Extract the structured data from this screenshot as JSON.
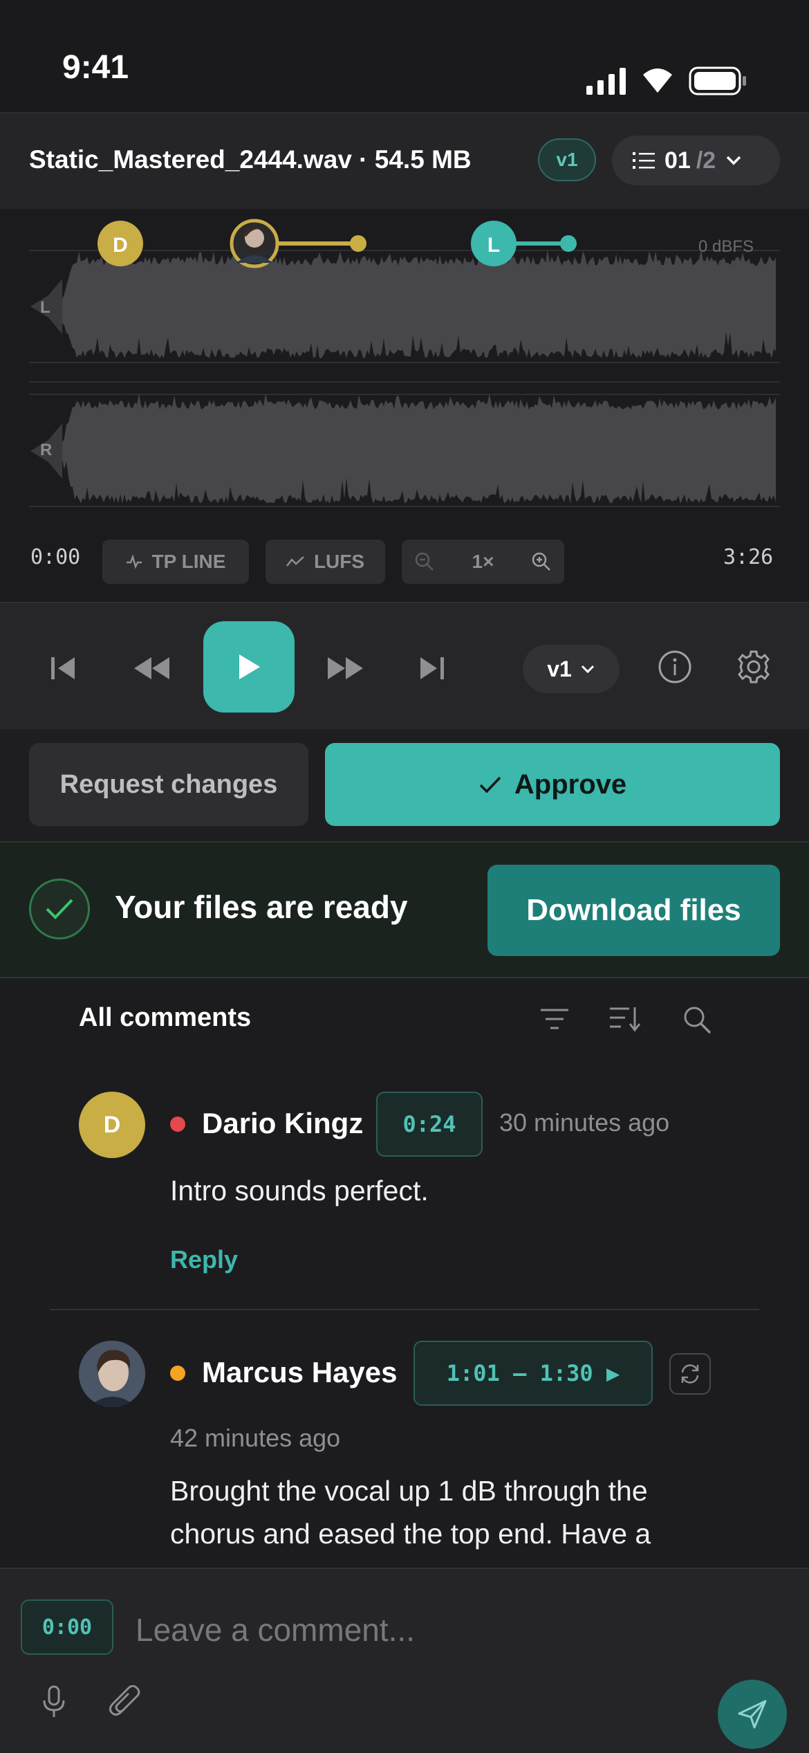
{
  "status_bar": {
    "time": "9:41"
  },
  "file": {
    "name": "Static_Mastered_2444.wav · 54.5 MB",
    "version_badge": "v1",
    "pager_current": "01",
    "pager_total": "/2"
  },
  "waveform": {
    "markers": [
      {
        "initial": "D",
        "color": "#c9ad45"
      },
      {
        "initial": "",
        "color": "#c9ad45"
      },
      {
        "initial": "L",
        "color": "#3cb8ac"
      }
    ],
    "dbfs_label": "0 dBFS",
    "channel_left": "L",
    "channel_right": "R",
    "start_time": "0:00",
    "end_time": "3:26",
    "tp_line_label": "TP LINE",
    "lufs_label": "LUFS",
    "zoom_level": "1×"
  },
  "transport": {
    "version_select": "v1"
  },
  "actions": {
    "request_changes": "Request changes",
    "approve": "Approve"
  },
  "ready_banner": {
    "text": "Your files are ready",
    "download": "Download files"
  },
  "comments": {
    "header": "All comments",
    "items": [
      {
        "author": "Dario Kingz",
        "initial": "D",
        "status_color": "#e5484d",
        "timestamp": "0:24",
        "time_ago": "30 minutes ago",
        "text": "Intro sounds perfect.",
        "reply_label": "Reply"
      },
      {
        "author": "Marcus Hayes",
        "status_color": "#f5a524",
        "timestamp": "1:01 — 1:30 ▶",
        "time_ago": "42 minutes ago",
        "text": "Brought the vocal up 1 dB through the chorus and eased the top end. Have a"
      }
    ]
  },
  "composer": {
    "timestamp": "0:00",
    "placeholder": "Leave a comment..."
  },
  "colors": {
    "accent": "#3cb8ac",
    "background": "#1c1c1f",
    "download": "#1e7f78"
  }
}
